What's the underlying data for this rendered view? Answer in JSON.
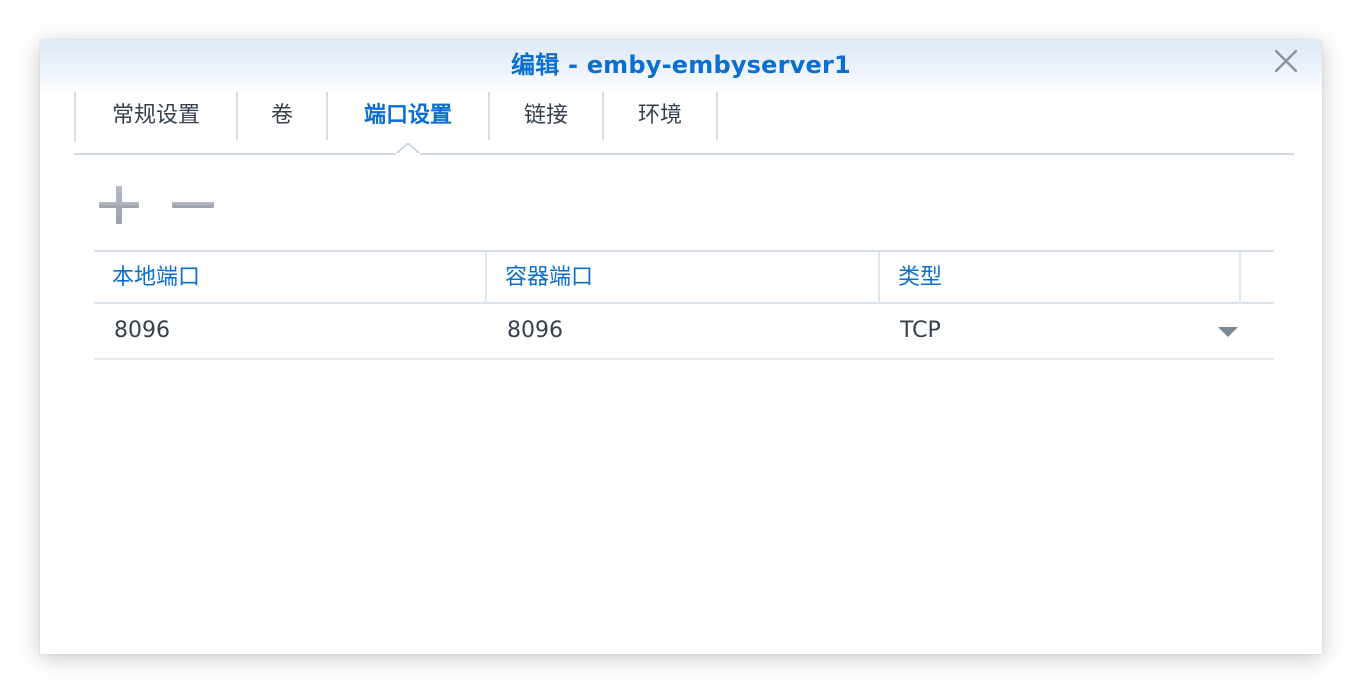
{
  "dialog": {
    "title": "编辑 - emby-embyserver1"
  },
  "tabs": [
    {
      "label": "常规设置",
      "active": false
    },
    {
      "label": "卷",
      "active": false
    },
    {
      "label": "端口设置",
      "active": true
    },
    {
      "label": "链接",
      "active": false
    },
    {
      "label": "环境",
      "active": false
    }
  ],
  "toolbar": {
    "add_icon": "plus-icon",
    "remove_icon": "minus-icon"
  },
  "port_table": {
    "columns": [
      "本地端口",
      "容器端口",
      "类型"
    ],
    "rows": [
      {
        "local_port": "8096",
        "container_port": "8096",
        "type": "TCP"
      }
    ]
  },
  "colors": {
    "accent": "#0a6fd1",
    "text": "#37414d",
    "border": "#d5dde6"
  }
}
